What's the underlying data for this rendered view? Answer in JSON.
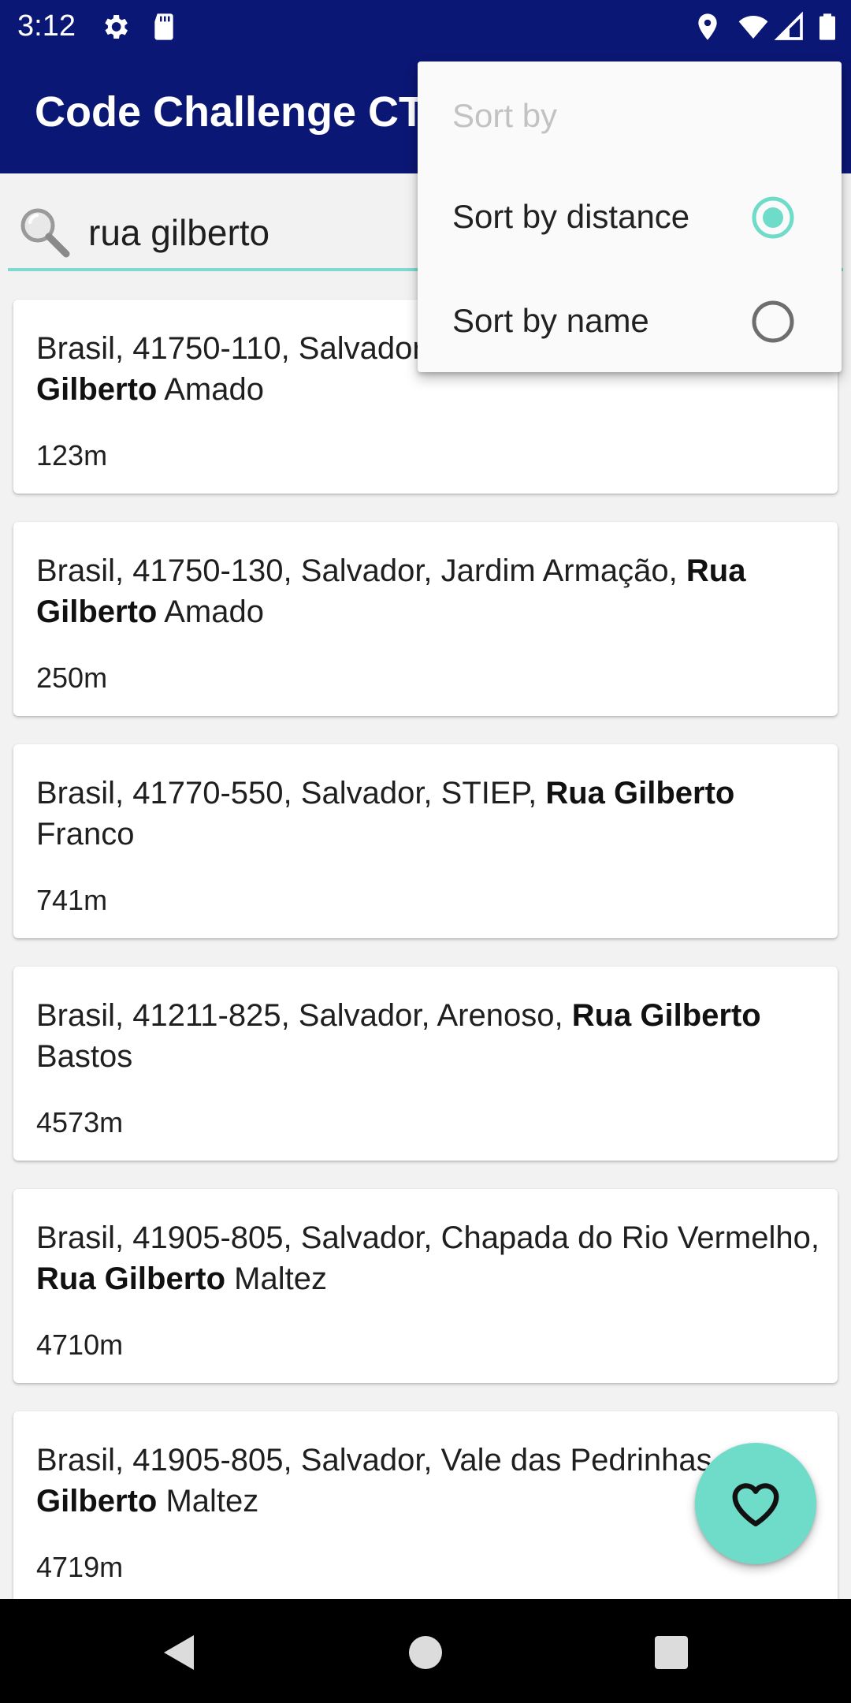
{
  "status_bar": {
    "time": "3:12",
    "left_icons": [
      "gear-icon",
      "sd-card-icon"
    ],
    "right_icons": [
      "location-icon",
      "wifi-icon",
      "signal-icon",
      "battery-icon"
    ]
  },
  "app_bar": {
    "title": "Code Challenge CTW"
  },
  "search": {
    "icon": "search-icon",
    "value": "rua gilberto"
  },
  "results": [
    {
      "address_pre": "Brasil, 41750-110, Salvador, Jardim Armação, ",
      "address_bold": "Rua Gilberto",
      "address_post": " Amado",
      "distance": "123m"
    },
    {
      "address_pre": "Brasil, 41750-130, Salvador, Jardim Armação, ",
      "address_bold": "Rua Gilberto",
      "address_post": " Amado",
      "distance": "250m"
    },
    {
      "address_pre": "Brasil, 41770-550, Salvador, STIEP, ",
      "address_bold": "Rua Gilberto",
      "address_post": " Franco",
      "distance": "741m"
    },
    {
      "address_pre": "Brasil, 41211-825, Salvador, Arenoso, ",
      "address_bold": "Rua Gilberto",
      "address_post": " Bastos",
      "distance": "4573m"
    },
    {
      "address_pre": "Brasil, 41905-805, Salvador, Chapada do Rio Vermelho, ",
      "address_bold": "Rua Gilberto",
      "address_post": " Maltez",
      "distance": "4710m"
    },
    {
      "address_pre": "Brasil, 41905-805, Salvador, Vale das Pedrinhas, ",
      "address_bold": "Rua Gilberto",
      "address_post": " Maltez",
      "distance": "4719m"
    }
  ],
  "sort_menu": {
    "header": "Sort by",
    "options": [
      {
        "label": "Sort by distance",
        "selected": true
      },
      {
        "label": "Sort by name",
        "selected": false
      }
    ]
  },
  "fab": {
    "icon": "heart-icon"
  },
  "nav_bar": {
    "buttons": [
      "back-icon",
      "home-icon",
      "recents-icon"
    ]
  },
  "colors": {
    "app_bar": "#0b1774",
    "accent": "#6fdcc9",
    "search_underline": "#7fd9d0",
    "background": "#f2f2f2",
    "menu_header": "#c2c2c2"
  }
}
